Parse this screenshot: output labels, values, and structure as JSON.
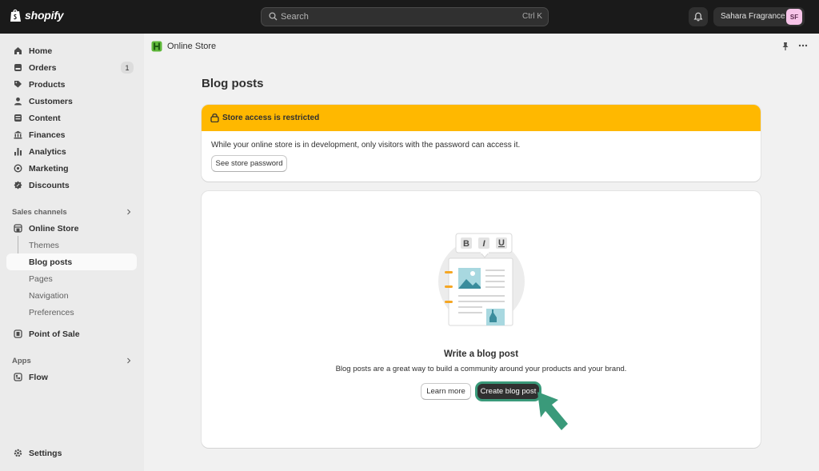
{
  "topbar": {
    "logo_text": "shopify",
    "search_placeholder": "Search",
    "search_shortcut": "Ctrl K",
    "store_name": "Sahara Fragrance",
    "avatar_initials": "SF"
  },
  "sidebar": {
    "items": [
      {
        "label": "Home",
        "icon": "home-icon"
      },
      {
        "label": "Orders",
        "icon": "orders-icon",
        "badge": "1"
      },
      {
        "label": "Products",
        "icon": "tag-icon"
      },
      {
        "label": "Customers",
        "icon": "person-icon"
      },
      {
        "label": "Content",
        "icon": "content-icon"
      },
      {
        "label": "Finances",
        "icon": "bank-icon"
      },
      {
        "label": "Analytics",
        "icon": "bar-chart-icon"
      },
      {
        "label": "Marketing",
        "icon": "target-icon"
      },
      {
        "label": "Discounts",
        "icon": "discount-icon"
      }
    ],
    "sales_channels_label": "Sales channels",
    "online_store": "Online Store",
    "online_store_sub": [
      "Themes",
      "Blog posts",
      "Pages",
      "Navigation",
      "Preferences"
    ],
    "point_of_sale": "Point of Sale",
    "apps_label": "Apps",
    "flow": "Flow",
    "settings": "Settings"
  },
  "header": {
    "title": "Online Store"
  },
  "page": {
    "title": "Blog posts",
    "banner": {
      "title": "Store access is restricted",
      "text": "While your online store is in development, only visitors with the password can access it.",
      "button": "See store password"
    },
    "empty_state": {
      "title": "Write a blog post",
      "description": "Blog posts are a great way to build a community around your products and your brand.",
      "secondary_button": "Learn more",
      "primary_button": "Create blog post",
      "toolbar_glyphs": [
        "B",
        "I",
        "U"
      ]
    }
  },
  "colors": {
    "banner": "#ffb800",
    "highlight": "#3a9a7a",
    "topbar": "#1a1a1a"
  }
}
